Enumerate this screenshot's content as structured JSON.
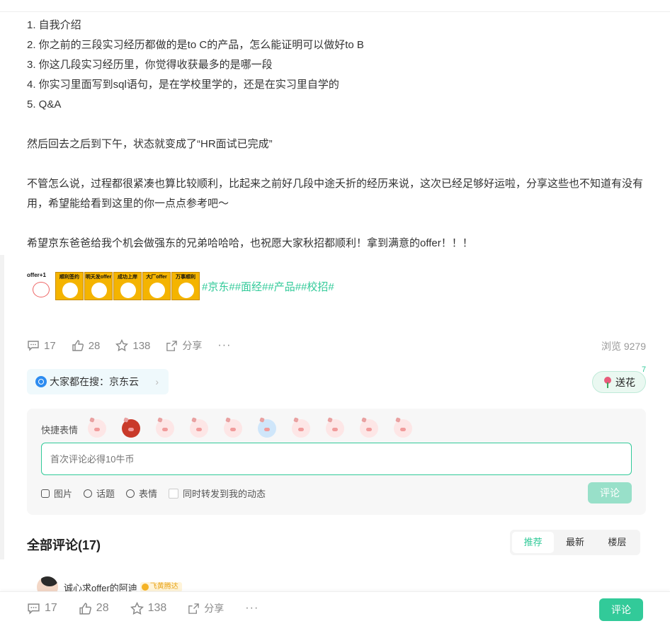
{
  "article": {
    "lines": [
      "1. 自我介绍",
      "2. 你之前的三段实习经历都做的是to C的产品，怎么能证明可以做好to B",
      "3. 你这几段实习经历里，你觉得收获最多的是哪一段",
      "4. 你实习里面写到sql语句，是在学校里学的，还是在实习里自学的",
      "5. Q&A"
    ],
    "para1": "然后回去之后到下午，状态就变成了“HR面试已完成”",
    "para2": "不管怎么说，过程都很紧凑也算比较顺利，比起来之前好几段中途夭折的经历来说，这次已经足够好运啦，分享这些也不知道有没有用，希望能给看到这里的你一点点参考吧～",
    "para3": "希望京东爸爸给我个机会做强东的兄弟哈哈哈，也祝愿大家秋招都顺利！拿到满意的offer！！！"
  },
  "stickers": {
    "first": "offer+1",
    "captions": [
      "顺利签约",
      "明天发offer",
      "成功上岸",
      "大厂offer",
      "万事顺利"
    ]
  },
  "tags": [
    "#京东#",
    "#面经#",
    "#产品#",
    "#校招#"
  ],
  "actions": {
    "comments": "17",
    "likes": "28",
    "stars": "138",
    "share": "分享",
    "more": "···",
    "views": "浏览 9279"
  },
  "search_hint": {
    "text": "大家都在搜：京东云",
    "arrow": "›"
  },
  "flower": {
    "label": "送花",
    "count": "7"
  },
  "comment_box": {
    "quick_label": "快捷表情",
    "placeholder": "首次评论必得10牛币",
    "tools": {
      "image": "图片",
      "topic": "话题",
      "emoji": "表情",
      "repost": "同时转发到我的动态"
    },
    "submit": "评论"
  },
  "comments_section": {
    "title": "全部评论(17)",
    "tabs": [
      "推荐",
      "最新",
      "楼层"
    ]
  },
  "first_comment": {
    "name": "诚心求offer的阿迪",
    "badge": "飞黄腾达"
  },
  "bottom": {
    "comments": "17",
    "likes": "28",
    "stars": "138",
    "share": "分享",
    "more": "···",
    "submit": "评论"
  },
  "colors": {
    "accent": "#32ca99",
    "accent_light": "#98e0c9",
    "text": "#333333",
    "muted": "#888888"
  }
}
